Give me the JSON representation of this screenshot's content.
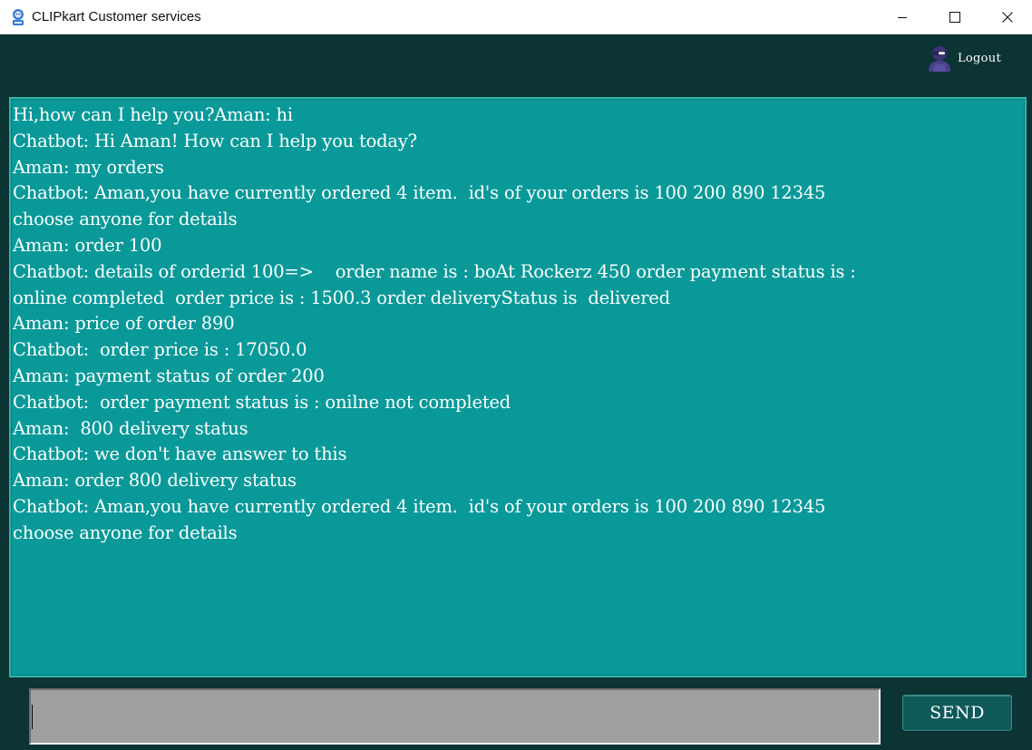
{
  "window": {
    "title": "CLIPkart Customer services",
    "controls": [
      "minimize-icon",
      "maximize-icon",
      "close-icon"
    ]
  },
  "header": {
    "logout_label": "Logout",
    "logout_icon": "ninja-user-icon"
  },
  "chat": {
    "lines": [
      "Hi,how can I help you?Aman: hi",
      "Chatbot: Hi Aman! How can I help you today?",
      "Aman: my orders",
      "Chatbot: Aman,you have currently ordered 4 item.  id's of your orders is 100 200 890 12345",
      "choose anyone for details",
      "Aman: order 100",
      "Chatbot: details of orderid 100=>    order name is : boAt Rockerz 450 order payment status is :",
      "online completed  order price is : 1500.3 order deliveryStatus is  delivered",
      "Aman: price of order 890",
      "Chatbot:  order price is : 17050.0",
      "Aman: payment status of order 200",
      "Chatbot:  order payment status is : onilne not completed",
      "Aman:  800 delivery status",
      "Chatbot: we don't have answer to this",
      "Aman: order 800 delivery status",
      "Chatbot: Aman,you have currently ordered 4 item.  id's of your orders is 100 200 890 12345",
      "choose anyone for details"
    ]
  },
  "composer": {
    "input_value": "",
    "send_label": "SEND"
  },
  "colors": {
    "app_background": "#0c3434",
    "chat_background": "#0a9999",
    "chat_text": "#ffffff",
    "input_background": "#a0a0a0",
    "send_button": "#0f5a5a"
  }
}
